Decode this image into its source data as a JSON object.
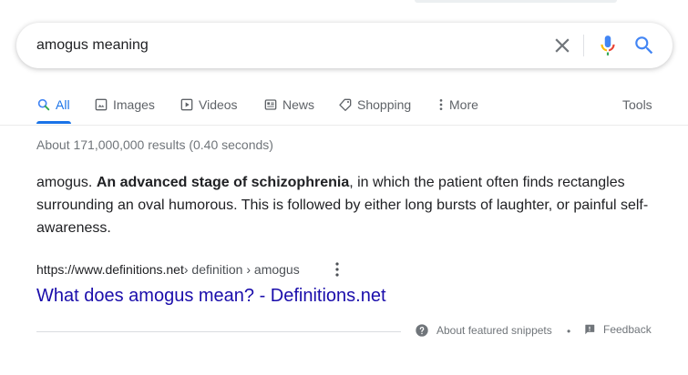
{
  "search": {
    "query": "amogus meaning",
    "clear_icon": "close-icon",
    "mic_icon": "microphone-icon",
    "search_icon": "search-icon"
  },
  "tabs": [
    {
      "label": "All",
      "icon": "search-icon",
      "active": true
    },
    {
      "label": "Images",
      "icon": "image-icon",
      "active": false
    },
    {
      "label": "Videos",
      "icon": "play-icon",
      "active": false
    },
    {
      "label": "News",
      "icon": "newspaper-icon",
      "active": false
    },
    {
      "label": "Shopping",
      "icon": "tag-icon",
      "active": false
    },
    {
      "label": "More",
      "icon": "vertical-dots-icon",
      "active": false
    }
  ],
  "tools_label": "Tools",
  "result_stats": "About 171,000,000 results (0.40 seconds)",
  "snippet": {
    "lead": "amogus. ",
    "bold": "An advanced stage of schizophrenia",
    "rest": ", in which the patient often finds rectangles surrounding an oval humorous. This is followed by either long bursts of laughter, or painful self-awareness."
  },
  "result": {
    "cite_domain": "https://www.definitions.net",
    "cite_path": " › definition › amogus",
    "title": "What does amogus mean? - Definitions.net"
  },
  "footer": {
    "about_label": "About featured snippets",
    "separator": "•",
    "feedback_label": "Feedback"
  },
  "colors": {
    "accent": "#1a73e8",
    "link": "#1a0dab",
    "muted": "#70757a"
  }
}
